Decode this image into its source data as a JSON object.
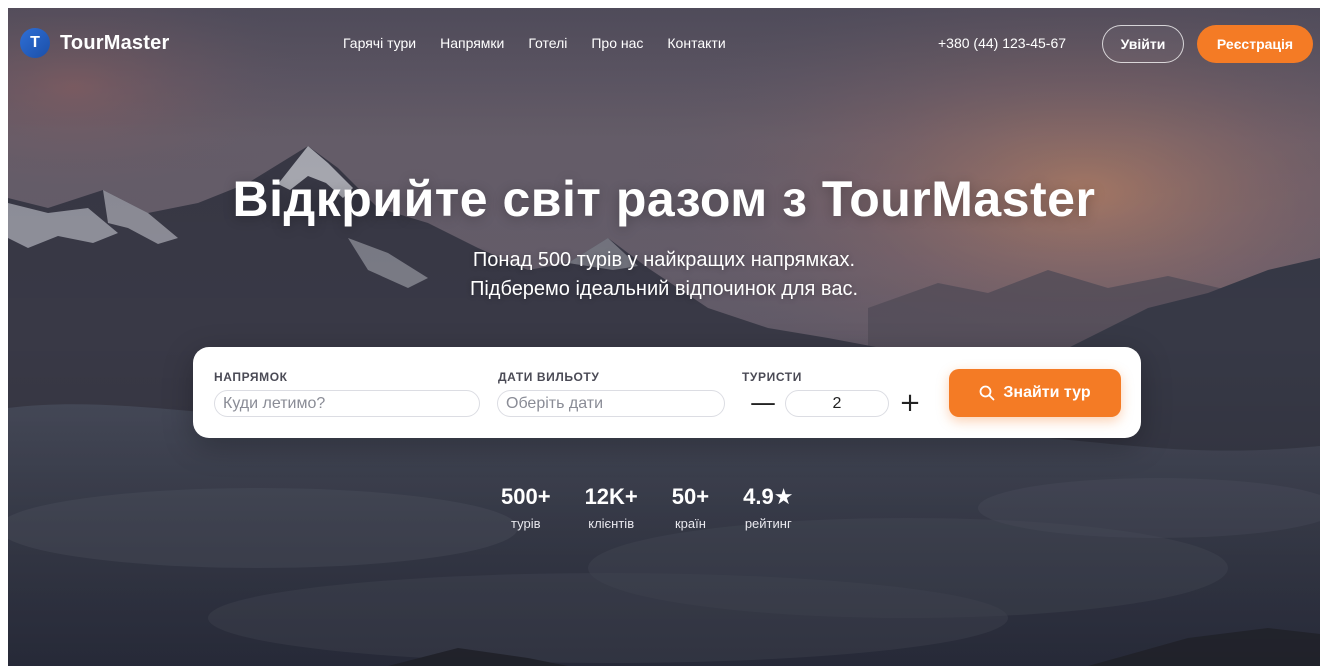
{
  "brand": {
    "logo_letter": "T",
    "name": "TourMaster"
  },
  "nav": {
    "items": [
      "Гарячі тури",
      "Напрямки",
      "Готелі",
      "Про нас",
      "Контакти"
    ],
    "phone": "+380 (44) 123-45-67",
    "login_label": "Увійти",
    "register_label": "Реєстрація"
  },
  "hero": {
    "title": "Відкрийте світ разом з TourMaster",
    "subtitle_line1": "Понад 500 турів у найкращих напрямках.",
    "subtitle_line2": "Підберемо ідеальний відпочинок для вас."
  },
  "search": {
    "destination_label": "НАПРЯМОК",
    "destination_placeholder": "Куди летимо?",
    "dates_label": "ДАТИ ВИЛЬОТУ",
    "dates_placeholder": "Оберіть дати",
    "tourists_label": "ТУРИСТИ",
    "tourists_value": "2",
    "minus": "—",
    "plus": "+",
    "button_label": "Знайти тур",
    "button_icon": "search-icon"
  },
  "stats": [
    {
      "value": "500+",
      "label": "турів"
    },
    {
      "value": "12K+",
      "label": "клієнтів"
    },
    {
      "value": "50+",
      "label": "країн"
    },
    {
      "value": "4.9★",
      "label": "рейтинг"
    }
  ],
  "colors": {
    "accent": "#f47b25",
    "logo_blue": "#2f6fd6"
  }
}
